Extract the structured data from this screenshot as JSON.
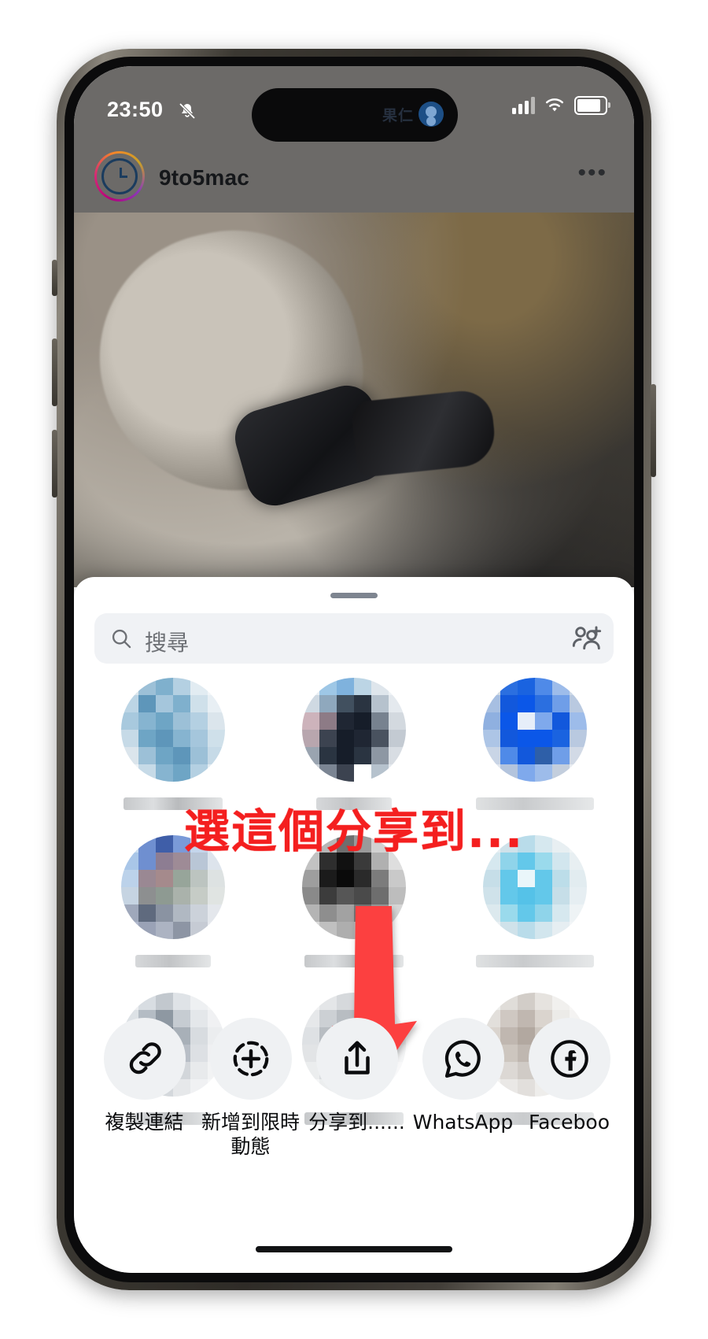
{
  "status_bar": {
    "time": "23:50",
    "silent_icon": "bell-slash-icon",
    "island_label": "果仁",
    "island_avatar_icon": "person-avatar-icon",
    "cellular_icon": "cellular-signal-icon",
    "wifi_icon": "wifi-icon",
    "battery_icon": "battery-icon"
  },
  "post": {
    "username": "9to5mac",
    "avatar_icon": "story-ring-avatar-icon",
    "more_icon": "more-options-icon",
    "more_glyph": "•••",
    "photo_alt": "apple-watch-on-wrist-photo"
  },
  "share_sheet": {
    "grabber": "sheet-grabber",
    "search": {
      "placeholder": "搜尋",
      "value": "",
      "icon": "search-icon",
      "add_people_icon": "add-people-icon"
    },
    "contacts": [
      {
        "name_width": "w1",
        "avatar": "blurred-contact-avatar-1"
      },
      {
        "name_width": "w2",
        "avatar": "blurred-contact-avatar-2"
      },
      {
        "name_width": "w3",
        "avatar": "blurred-contact-avatar-3"
      },
      {
        "name_width": "w2",
        "avatar": "blurred-contact-avatar-4"
      },
      {
        "name_width": "w1",
        "avatar": "blurred-contact-avatar-5"
      },
      {
        "name_width": "w3",
        "avatar": "blurred-contact-avatar-6"
      },
      {
        "name_width": "w2",
        "avatar": "blurred-contact-avatar-7"
      },
      {
        "name_width": "w1",
        "avatar": "blurred-contact-avatar-8"
      },
      {
        "name_width": "w3",
        "avatar": "blurred-contact-avatar-9"
      }
    ],
    "actions": [
      {
        "label": "複製連結",
        "icon": "link-icon"
      },
      {
        "label": "新增到限時\n動態",
        "icon": "add-to-story-icon"
      },
      {
        "label": "分享到......",
        "icon": "share-out-icon"
      },
      {
        "label": "WhatsApp",
        "icon": "whatsapp-icon"
      },
      {
        "label": "Faceboo",
        "icon": "facebook-icon"
      }
    ]
  },
  "annotation": {
    "text": "選這個分享到...",
    "color": "#f41f1f",
    "arrow_icon": "red-down-arrow-icon",
    "arrow_color": "#fc4040"
  },
  "home_indicator": "home-indicator"
}
